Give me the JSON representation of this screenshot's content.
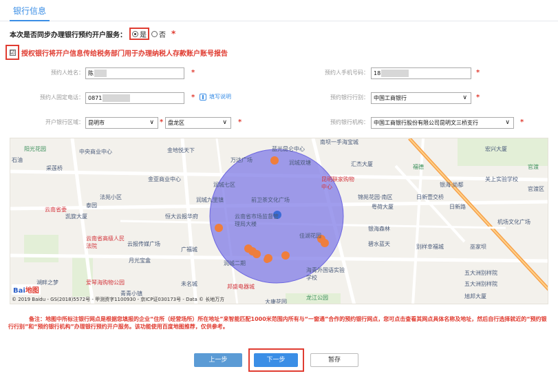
{
  "tab": {
    "label": "银行信息"
  },
  "question": {
    "label": "本次是否同步办理银行预约开户服务：",
    "yes": "是",
    "no": "否",
    "required": "*"
  },
  "authorize": {
    "check": "☑",
    "text": "授权银行将开户信息传给税务部门用于办理纳税人存款账户账号报告"
  },
  "form": {
    "booker_name_label": "预约人姓名：",
    "booker_name_value": "陈",
    "booker_phone_label": "预约人手机号码：",
    "booker_phone_value": "18",
    "booker_landline_label": "预约人固定电话：",
    "booker_landline_value": "0871",
    "help_text": "填写说明",
    "bank_type_label": "预约银行行别：",
    "bank_type_value": "中国工商银行",
    "region_label": "开户银行区域：",
    "city_value": "昆明市",
    "district_value": "盘龙区",
    "bank_org_label": "预约银行机构：",
    "bank_org_value": "中国工商银行股份有限公司昆明文三桥支行",
    "star": "*",
    "chevron": "∨"
  },
  "map": {
    "labels": [
      "阳光花园",
      "中央商业中心",
      "金地悦天下",
      "蓝光昆仑中心",
      "南坝一手海宝城",
      "宏兴大厦",
      "石油",
      "采莲桥",
      "万达广场",
      "润城双塘",
      "汇杰大厦",
      "福德",
      "官渡",
      "金亚商业中心",
      "润城七区",
      "昆明联家购物中心",
      "银海·尚都",
      "关上实验学校",
      "官渡区",
      "法苑小区",
      "锦苑花园·南区",
      "润城九里镇",
      "前卫茶文化广场",
      "粤荷大厦",
      "日新壹交桥",
      "日新路",
      "云南省委",
      "泰园",
      "凯旋大厦",
      "恒大云报华府",
      "云南省市场监督管理局大楼",
      "银海森林",
      "机场文化广场",
      "云南省高级人民法院",
      "云报传媒广场",
      "广福城",
      "润城二期",
      "佳湖花园",
      "碧水蓝天",
      "别样幸福城",
      "巫家坝",
      "月光宝盒",
      "海青外国语实验学校",
      "五大洲别样院",
      "湖畔之梦",
      "爱琴海购物公园",
      "未名城",
      "邦盛电器城",
      "五大洲别样院",
      "青青小镇",
      "大康花园",
      "龙江公园",
      "旭邦大厦"
    ],
    "logo_text": "Bai",
    "logo_suffix": "地图",
    "copyright": "© 2019 Baidu - GS(2018)5572号 - 甲测资字1100930 - 京ICP证030173号 - Data © 长地万方"
  },
  "note": "备注：地图中所标注银行网点是根据您填报的企业“住所（经营场所）所在地址”来智能匹配1000米范围内所有与“一窗通”合作的预约银行网点，您可点击查看其网点具体名称及地址，然后自行选择就近的“预约银行行别”和“预约银行机构”办理银行预约开户服务。该功能使用百度地图推荐，仅供参考。",
  "buttons": {
    "prev": "上一步",
    "next": "下一步",
    "save": "暂存"
  },
  "colors": {
    "accent": "#3a8ee6",
    "required": "#e03c31",
    "circle": "#7b77e6"
  }
}
